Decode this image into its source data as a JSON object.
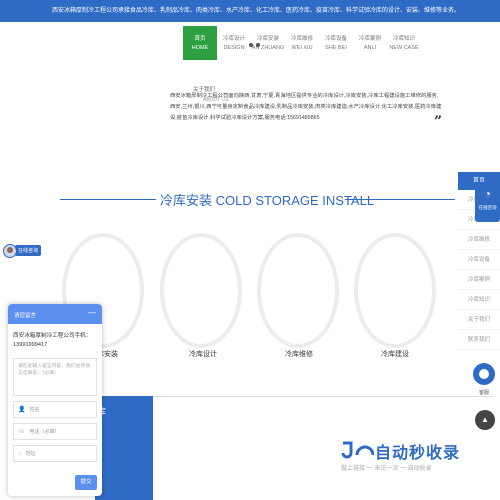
{
  "topbar": {
    "text": "西安冰箱厚制冷工程公司承接食品冷库、乳制品冷库、肉类冷库、水产冷库、化工冷库、医药冷库、疫苗冷库、科学试验冷库的设计、安装、维修等业务。"
  },
  "nav": {
    "items": [
      {
        "zh": "首页",
        "en": "HOME",
        "active": true
      },
      {
        "zh": "冷库设计",
        "en": "DESIGN"
      },
      {
        "zh": "冷库安装",
        "en": "AN ZHUANG"
      },
      {
        "zh": "冷库维修",
        "en": "WEI XIU"
      },
      {
        "zh": "冷库设备",
        "en": "SHE BEI"
      },
      {
        "zh": "冷库案例",
        "en": "ANLI"
      },
      {
        "zh": "冷库知识",
        "en": "NEW CASE"
      }
    ]
  },
  "about": {
    "title": "关于我们",
    "en": "ABOUT US",
    "text": "西安冰箱厚制冷工程公司面向陕西,甘肃,宁夏,青海地区提供专业的冷库设计,冷库安装,冷库工程建设施工维修的服务,西安,兰州,银川,西宁可量身定制食品冷库建设,乳制品冷库安装,肉类冷库建造,水产冷库设计,化工冷库安装,医药冷库建设,疫苗冷库设计,科学试验冷库设计方案,服务电话:15691489865",
    "quote": "”"
  },
  "section": {
    "title": "冷库安装 COLD STORAGE INSTALL",
    "categories": [
      "冷库安装",
      "冷库设计",
      "冷库维修",
      "冷库建设"
    ]
  },
  "bottom_block": {
    "zh": "库",
    "en": "e"
  },
  "chat": {
    "label": "在线咨询",
    "avatar_icon": "agent-avatar-icon"
  },
  "message_panel": {
    "title": "请您留言",
    "minimize": "—",
    "company": "西安冰箱厚制冷工程公司手机：13991999417",
    "textarea_placeholder": "请在此输入留言内容，我们会尽快与您联系。（必填）",
    "fields": [
      {
        "icon": "user-icon",
        "glyph": "👤",
        "placeholder": "姓名"
      },
      {
        "icon": "phone-icon",
        "glyph": "☏",
        "placeholder": "电话（必填）"
      },
      {
        "icon": "location-icon",
        "glyph": "⌂",
        "placeholder": "地址"
      }
    ],
    "submit": "提交"
  },
  "right_sidebar": {
    "home": "首页",
    "items": [
      "冷库安装",
      "冷库设计",
      "冷库维修",
      "冷库设备",
      "冷库案例",
      "冷库知识",
      "关于我们",
      "联系我们"
    ],
    "online_label": "在线咨询",
    "service_label": "客服",
    "top": "▲"
  },
  "watermark": {
    "main": "自动秒收录",
    "sub": "做上链接 一 来访一次 一 自动收录"
  },
  "colors": {
    "brand": "#2f6bc4",
    "nav_active": "#2ea042"
  }
}
